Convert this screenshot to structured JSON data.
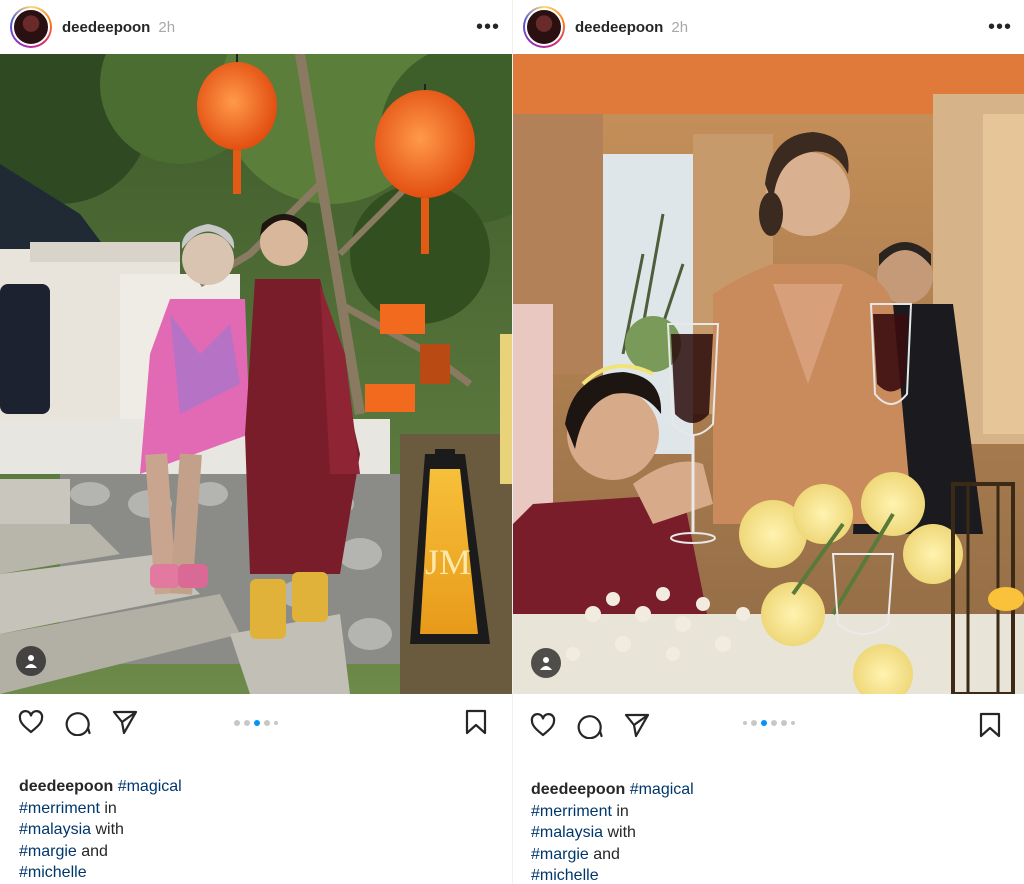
{
  "posts": [
    {
      "username": "deedeepoon",
      "time": "2h",
      "more": "•••",
      "carousel": {
        "count": 5,
        "active_index": 2
      },
      "caption": {
        "username": "deedeepoon",
        "lines": [
          {
            "hash": "#magical",
            "text": ""
          },
          {
            "hash": "#merriment",
            "text": " in"
          },
          {
            "hash": "#malaysia",
            "text": " with"
          },
          {
            "hash": "#margie",
            "text": " and"
          },
          {
            "hash": "#michelle",
            "text": ""
          }
        ]
      },
      "lantern_monogram": "JM"
    },
    {
      "username": "deedeepoon",
      "time": "2h",
      "more": "•••",
      "carousel": {
        "count": 6,
        "active_index": 2
      },
      "caption": {
        "username": "deedeepoon",
        "lines": [
          {
            "hash": "#magical",
            "text": ""
          },
          {
            "hash": "#merriment",
            "text": " in"
          },
          {
            "hash": "#malaysia",
            "text": " with"
          },
          {
            "hash": "#margie",
            "text": " and"
          },
          {
            "hash": "#michelle",
            "text": ""
          }
        ]
      }
    }
  ],
  "colors": {
    "hashtag": "#00376b",
    "active_dot": "#0095f6",
    "lantern": "#f0641e"
  },
  "icons": [
    "heart-icon",
    "comment-icon",
    "share-icon",
    "bookmark-icon",
    "more-icon",
    "tag-person-icon"
  ]
}
